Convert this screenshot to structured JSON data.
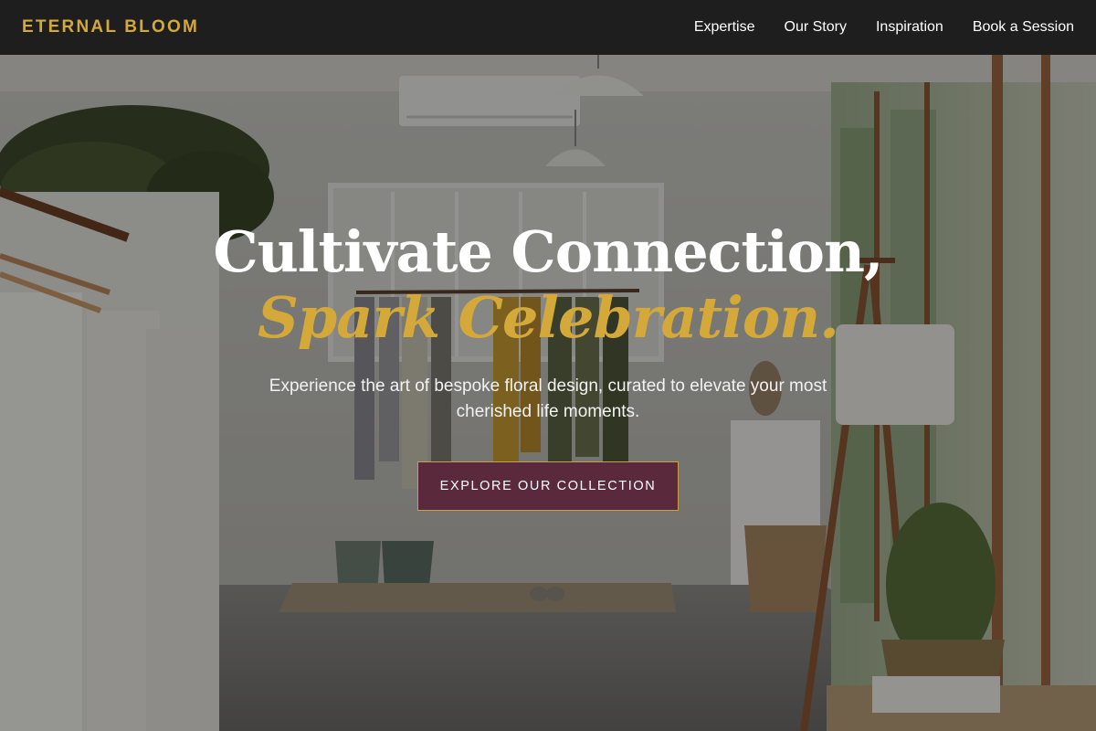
{
  "nav": {
    "brand": "ETERNAL BLOOM",
    "links": [
      {
        "label": "Expertise"
      },
      {
        "label": "Our Story"
      },
      {
        "label": "Inspiration"
      },
      {
        "label": "Book a Session"
      }
    ]
  },
  "hero": {
    "headline_line1": "Cultivate Connection,",
    "headline_line2": "Spark Celebration.",
    "subtitle": "Experience the art of bespoke floral design, curated to elevate your most cherished life moments.",
    "cta_label": "EXPLORE OUR COLLECTION",
    "background_description": "boutique-interior-photo"
  },
  "colors": {
    "accent_gold": "#d4a93a",
    "cta_plum": "#5a2a3c",
    "navbar_bg": "#1e1e1e"
  }
}
